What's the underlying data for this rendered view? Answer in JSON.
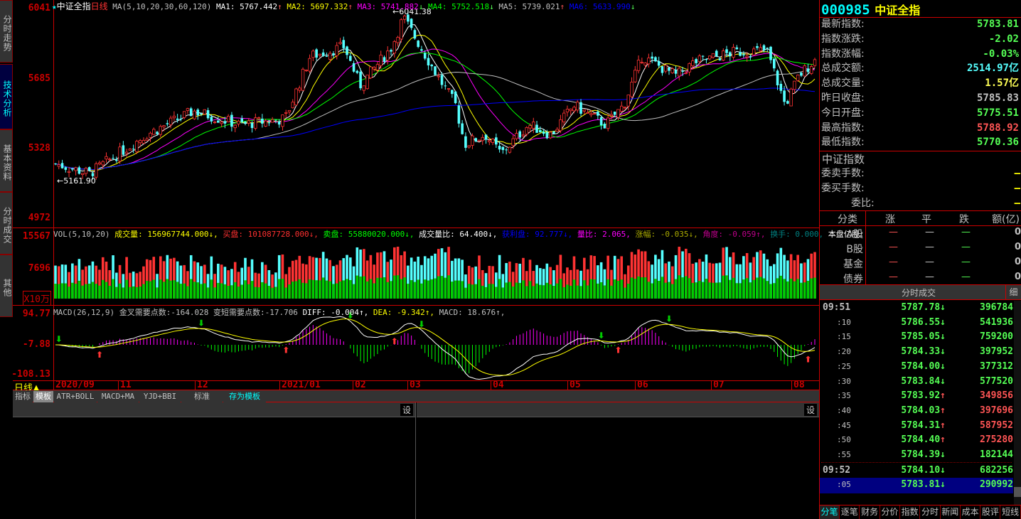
{
  "side_tabs": [
    "分时走势",
    "技术分析",
    "基本资料",
    "分时成交",
    "其他"
  ],
  "price_axis": [
    "6041",
    "5685",
    "5328",
    "4972"
  ],
  "vol_axis": [
    "15567",
    "7696"
  ],
  "vol_unit": "X10万",
  "macd_axis": [
    "94.77",
    "-7.88",
    "-108.13"
  ],
  "main_header": {
    "star": "★",
    "name": "中证全指",
    "period": "日线",
    "ma_params": "MA(5,10,20,30,60,120)",
    "ma": [
      {
        "label": "MA1: 5767.442",
        "arrow": "↑",
        "color": "#ffffff"
      },
      {
        "label": "MA2: 5697.332",
        "arrow": "↑",
        "color": "#ffff00"
      },
      {
        "label": "MA3: 5741.882",
        "arrow": "↓",
        "color": "#ff00ff"
      },
      {
        "label": "MA4: 5752.518",
        "arrow": "↓",
        "color": "#00ff00"
      },
      {
        "label": "MA5: 5739.021",
        "arrow": "↑",
        "color": "#c0c0c0"
      },
      {
        "label": "MA6: 5633.990",
        "arrow": "↓",
        "color": "#0000ff"
      }
    ],
    "high_label": "6041.38",
    "low_label": "5161.90"
  },
  "vol_header": [
    {
      "t": "VOL(5,10,20)",
      "c": "#c0c0c0"
    },
    {
      "t": "成交量: 156967744.000↓,",
      "c": "#ffff00"
    },
    {
      "t": "买盘: 101087728.000↓,",
      "c": "#ff3030"
    },
    {
      "t": "卖盘: 55880020.000↓,",
      "c": "#00ff00"
    },
    {
      "t": "成交量比: 64.400↓,",
      "c": "#ffffff"
    },
    {
      "t": "获利盘: 92.777↓,",
      "c": "#0000ff"
    },
    {
      "t": "量比: 2.065,",
      "c": "#ff00ff"
    },
    {
      "t": "涨幅: -0.035↓,",
      "c": "#aaaa00"
    },
    {
      "t": "角度: -0.059↑,",
      "c": "#c0008c"
    },
    {
      "t": "换手: 0.000,",
      "c": "#008080"
    },
    {
      "t": "本盘亿股:",
      "c": "#ffffff"
    }
  ],
  "macd_header": [
    {
      "t": "MACD(26,12,9)",
      "c": "#c0c0c0"
    },
    {
      "t": "金叉需要点数:-164.028",
      "c": "#c0c0c0"
    },
    {
      "t": "变短需要点数:-17.706",
      "c": "#c0c0c0"
    },
    {
      "t": "DIFF: -0.004↑,",
      "c": "#ffffff"
    },
    {
      "t": "DEA: -9.342↑,",
      "c": "#ffff00"
    },
    {
      "t": "MACD: 18.676↑,",
      "c": "#c0c0c0"
    }
  ],
  "period_label": "日线▲",
  "x_axis": [
    "2020/09",
    "11",
    "12",
    "2021/01",
    "02",
    "03",
    "04",
    "05",
    "06",
    "07",
    "08"
  ],
  "template_tabs": [
    "指标",
    "模板",
    "ATR+BOLL",
    "MACD+MA",
    "YJD+BBI",
    "标准",
    "存为模板"
  ],
  "settings_label": "设",
  "chart_data": {
    "type": "candlestick",
    "price_range": [
      4972,
      6041
    ],
    "high": 6041.38,
    "low": 5161.9,
    "key_closes": [
      [
        "2020-09-10",
        5250
      ],
      [
        "2020-09-25",
        5200
      ],
      [
        "2020-10-20",
        5400
      ],
      [
        "2020-11-10",
        5520
      ],
      [
        "2020-11-30",
        5450
      ],
      [
        "2020-12-20",
        5480
      ],
      [
        "2020-12-31",
        5800
      ],
      [
        "2021-01-15",
        5850
      ],
      [
        "2021-01-22",
        5650
      ],
      [
        "2021-02-05",
        5850
      ],
      [
        "2021-02-10",
        6000
      ],
      [
        "2021-02-25",
        5700
      ],
      [
        "2021-03-05",
        5550
      ],
      [
        "2021-03-09",
        5350
      ],
      [
        "2021-03-18",
        5400
      ],
      [
        "2021-03-25",
        5300
      ],
      [
        "2021-04-06",
        5450
      ],
      [
        "2021-04-16",
        5400
      ],
      [
        "2021-04-26",
        5550
      ],
      [
        "2021-05-10",
        5450
      ],
      [
        "2021-05-18",
        5550
      ],
      [
        "2021-05-26",
        5800
      ],
      [
        "2021-06-10",
        5700
      ],
      [
        "2021-06-18",
        5770
      ],
      [
        "2021-07-05",
        5820
      ],
      [
        "2021-07-20",
        5830
      ],
      [
        "2021-07-28",
        5550
      ],
      [
        "2021-08-03",
        5700
      ],
      [
        "2021-08-10",
        5784
      ]
    ]
  },
  "quote": {
    "code": "000985",
    "name": "中证全指",
    "rows": [
      {
        "k": "最新指数:",
        "v": "5783.81",
        "c": "#5f5"
      },
      {
        "k": "指数涨跌:",
        "v": "-2.02",
        "c": "#5f5"
      },
      {
        "k": "指数涨幅:",
        "v": "-0.03%",
        "c": "#5f5"
      },
      {
        "k": "总成交额:",
        "v": "2514.97亿",
        "c": "#5ff"
      },
      {
        "k": "总成交量:",
        "v": "1.57亿",
        "c": "#ff5"
      },
      {
        "k": "昨日收盘:",
        "v": "5785.83",
        "c": "#c0c0c0"
      },
      {
        "k": "今日开盘:",
        "v": "5775.51",
        "c": "#5f5"
      },
      {
        "k": "最高指数:",
        "v": "5788.92",
        "c": "#f55"
      },
      {
        "k": "最低指数:",
        "v": "5770.36",
        "c": "#5f5"
      }
    ],
    "section": "中证指数",
    "order_rows": [
      {
        "k": "委卖手数:",
        "v": "—"
      },
      {
        "k": "委买手数:",
        "v": "—"
      },
      {
        "k": "委比:",
        "v": "—"
      }
    ],
    "cat_header": [
      "分类",
      "涨",
      "平",
      "跌",
      "额(亿)"
    ],
    "cats": [
      {
        "n": "A股",
        "up": "—",
        "flat": "—",
        "down": "—",
        "amt": "0"
      },
      {
        "n": "B股",
        "up": "—",
        "flat": "—",
        "down": "—",
        "amt": "0"
      },
      {
        "n": "基金",
        "up": "—",
        "flat": "—",
        "down": "—",
        "amt": "0"
      },
      {
        "n": "债券",
        "up": "—",
        "flat": "—",
        "down": "—",
        "amt": "0"
      }
    ]
  },
  "ticks": {
    "title": "分时成交",
    "detail": "细",
    "rows": [
      {
        "t": "09:51",
        "p": "5787.78",
        "a": "↓",
        "v": "396784"
      },
      {
        "t": ":10",
        "p": "5786.55",
        "a": "↓",
        "v": "541936"
      },
      {
        "t": ":15",
        "p": "5785.05",
        "a": "↓",
        "v": "759200"
      },
      {
        "t": ":20",
        "p": "5784.33",
        "a": "↓",
        "v": "397952"
      },
      {
        "t": ":25",
        "p": "5784.00",
        "a": "↓",
        "v": "377312"
      },
      {
        "t": ":30",
        "p": "5783.84",
        "a": "↓",
        "v": "577520"
      },
      {
        "t": ":35",
        "p": "5783.92",
        "a": "↑",
        "v": "349856"
      },
      {
        "t": ":40",
        "p": "5784.03",
        "a": "↑",
        "v": "397696"
      },
      {
        "t": ":45",
        "p": "5784.31",
        "a": "↑",
        "v": "587952"
      },
      {
        "t": ":50",
        "p": "5784.40",
        "a": "↑",
        "v": "275280"
      },
      {
        "t": ":55",
        "p": "5784.39",
        "a": "↓",
        "v": "182144"
      },
      {
        "t": "09:52",
        "p": "5784.10",
        "a": "↓",
        "v": "682256"
      },
      {
        "t": ":05",
        "p": "5783.81",
        "a": "↓",
        "v": "290992"
      }
    ]
  },
  "footer_tabs": [
    "分笔",
    "逐笔",
    "财务",
    "分价",
    "指数",
    "分时",
    "新闻",
    "成本",
    "股评",
    "短线"
  ]
}
